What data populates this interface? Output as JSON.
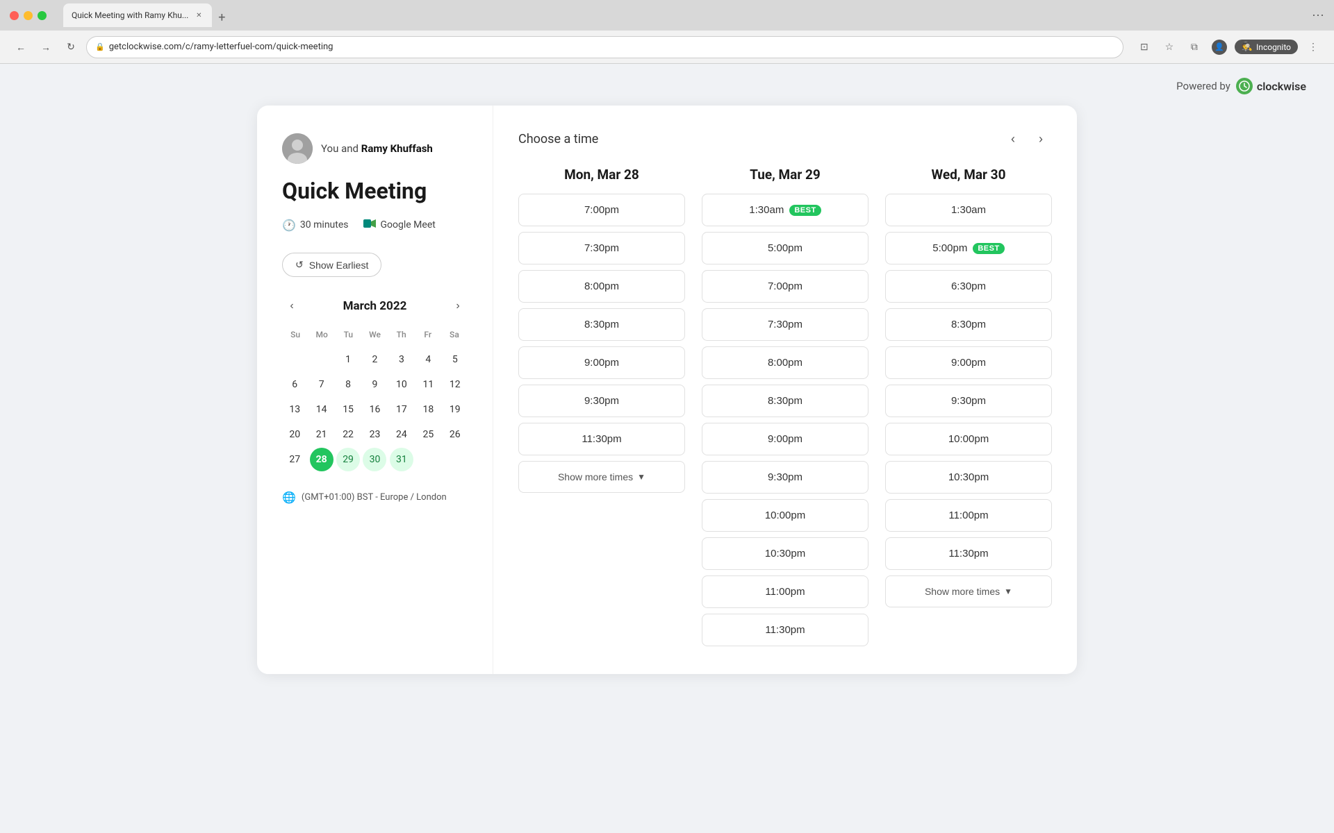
{
  "browser": {
    "tab_title": "Quick Meeting with Ramy Khu...",
    "url": "getclockwise.com/c/ramy-letterfuel-com/quick-meeting",
    "incognito_label": "Incognito"
  },
  "powered_by": {
    "label": "Powered by",
    "brand": "clockwise"
  },
  "left_panel": {
    "user_label": "You and",
    "user_name": "Ramy Khuffash",
    "meeting_title": "Quick Meeting",
    "duration": "30 minutes",
    "conference": "Google Meet",
    "show_earliest_label": "Show Earliest",
    "calendar_month": "March 2022",
    "day_labels": [
      "Su",
      "Mo",
      "Tu",
      "We",
      "Th",
      "Fr",
      "Sa"
    ],
    "weeks": [
      [
        "",
        "",
        "1",
        "2",
        "3",
        "4",
        "5"
      ],
      [
        "6",
        "7",
        "8",
        "9",
        "10",
        "11",
        "12"
      ],
      [
        "13",
        "14",
        "15",
        "16",
        "17",
        "18",
        "19"
      ],
      [
        "20",
        "21",
        "22",
        "23",
        "24",
        "25",
        "26"
      ],
      [
        "27",
        "28",
        "29",
        "30",
        "31",
        "",
        ""
      ]
    ],
    "selected_dates": [
      "28",
      "29",
      "30",
      "31"
    ],
    "today_date": "28",
    "timezone": "(GMT+01:00) BST - Europe / London"
  },
  "right_panel": {
    "choose_time_title": "Choose a time",
    "columns": [
      {
        "header": "Mon, Mar 28",
        "slots": [
          {
            "time": "7:00pm",
            "best": false
          },
          {
            "time": "7:30pm",
            "best": false
          },
          {
            "time": "8:00pm",
            "best": false
          },
          {
            "time": "8:30pm",
            "best": false
          },
          {
            "time": "9:00pm",
            "best": false
          },
          {
            "time": "9:30pm",
            "best": false
          },
          {
            "time": "11:30pm",
            "best": false
          }
        ],
        "show_more": true,
        "show_more_label": "Show more times"
      },
      {
        "header": "Tue, Mar 29",
        "slots": [
          {
            "time": "1:30am",
            "best": true
          },
          {
            "time": "5:00pm",
            "best": false
          },
          {
            "time": "7:00pm",
            "best": false
          },
          {
            "time": "7:30pm",
            "best": false
          },
          {
            "time": "8:00pm",
            "best": false
          },
          {
            "time": "8:30pm",
            "best": false
          },
          {
            "time": "9:00pm",
            "best": false
          },
          {
            "time": "9:30pm",
            "best": false
          },
          {
            "time": "10:00pm",
            "best": false
          },
          {
            "time": "10:30pm",
            "best": false
          },
          {
            "time": "11:00pm",
            "best": false
          },
          {
            "time": "11:30pm",
            "best": false
          }
        ],
        "show_more": false,
        "show_more_label": "Show more times"
      },
      {
        "header": "Wed, Mar 30",
        "slots": [
          {
            "time": "1:30am",
            "best": false
          },
          {
            "time": "5:00pm",
            "best": true
          },
          {
            "time": "6:30pm",
            "best": false
          },
          {
            "time": "8:30pm",
            "best": false
          },
          {
            "time": "9:00pm",
            "best": false
          },
          {
            "time": "9:30pm",
            "best": false
          },
          {
            "time": "10:00pm",
            "best": false
          },
          {
            "time": "10:30pm",
            "best": false
          },
          {
            "time": "11:00pm",
            "best": false
          },
          {
            "time": "11:30pm",
            "best": false
          }
        ],
        "show_more": true,
        "show_more_label": "Show more times"
      }
    ]
  }
}
